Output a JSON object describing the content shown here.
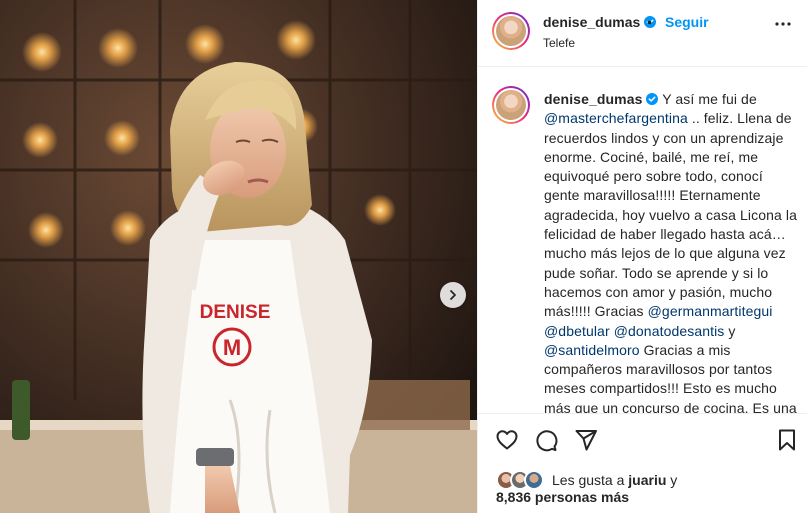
{
  "header": {
    "username": "denise_dumas",
    "separator": "•",
    "follow_label": "Seguir",
    "subtitle": "Telefe"
  },
  "media": {
    "apron_text": "DENISE",
    "apron_logo": "M"
  },
  "caption": {
    "username": "denise_dumas",
    "part1": " Y así me fui de ",
    "mention1": "@masterchefargentina",
    "part2": " .. feliz. Llena de recuerdos lindos y con un aprendizaje enorme. Cociné, bailé, me reí, me equivoqué pero sobre todo, conocí gente maravillosa!!!!! Eternamente agradecida, hoy vuelvo a casa Licona la felicidad de haber llegado hasta acá… mucho más lejos de lo que alguna vez pude soñar. Todo se aprende y si lo hacemos con amor y pasión, mucho más!!!!! Gracias ",
    "mention2": "@germanmartitegui",
    "sep2": " ",
    "mention3": "@dbetular",
    "sep3": " ",
    "mention4": "@donatodesantis",
    "part3": " y ",
    "mention5": "@santidelmoro",
    "part4": " Gracias a mis compañeros maravillosos por tantos meses compartidos!!! Esto es mucho más que un concurso de cocina. Es una experiencia que nos enfrenta a todos"
  },
  "likes": {
    "prefix": "Les gusta a ",
    "user": "juariu",
    "suffix": " y",
    "count": "8,836 personas más"
  },
  "icons": [
    "more-icon",
    "verified-icon",
    "heart-icon",
    "comment-icon",
    "share-icon",
    "bookmark-icon",
    "chevron-right-icon"
  ],
  "colors": {
    "accent": "#0095f6",
    "mention": "#00376b",
    "verified": "#0095f6",
    "text": "#262626"
  }
}
